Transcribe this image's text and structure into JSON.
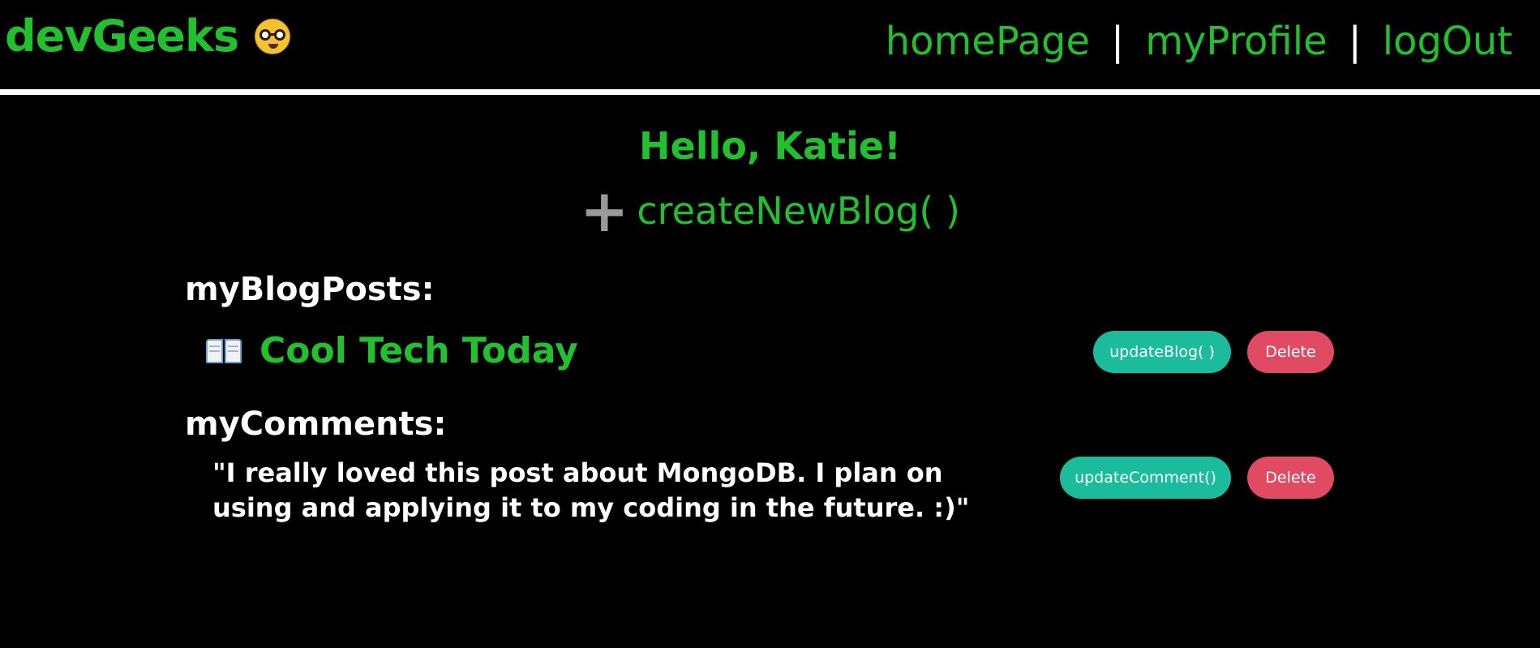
{
  "header": {
    "brand": "devGeeks",
    "brand_icon": "nerd-face-icon",
    "nav": {
      "home": "homePage",
      "profile": "myProfile",
      "logout": "logOut",
      "separator": "|"
    }
  },
  "main": {
    "greeting": "Hello, Katie!",
    "create_icon": "plus-icon",
    "create_label": "createNewBlog( )",
    "blog_section_title": "myBlogPosts:",
    "blogs": [
      {
        "icon": "open-book-icon",
        "title": "Cool Tech Today",
        "update_label": "updateBlog( )",
        "delete_label": "Delete"
      }
    ],
    "comment_section_title": "myComments:",
    "comments": [
      {
        "text": "\"I really loved this post about MongoDB. I plan on using and applying it to my coding in the future. :)\"",
        "update_label": "updateComment()",
        "delete_label": "Delete"
      }
    ]
  },
  "colors": {
    "background": "#000000",
    "accent_green": "#22c02f",
    "text_white": "#ffffff",
    "button_teal": "#1bbc9b",
    "button_red": "#e04b63",
    "plus_gray": "#9a9a9a"
  }
}
